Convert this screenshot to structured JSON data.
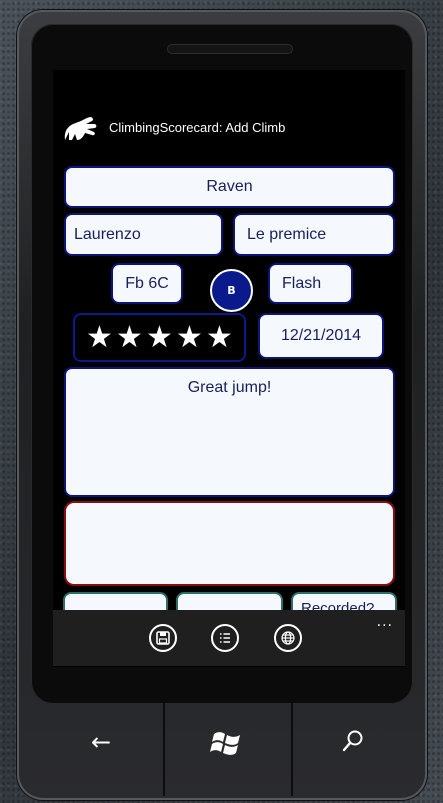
{
  "app": {
    "title": "ClimbingScorecard: Add Climb"
  },
  "form": {
    "route_name": "Raven",
    "climber": "Laurenzo",
    "problem": "Le premice",
    "grade": "Fb 6C",
    "badge": "B",
    "style": "Flash",
    "rating_stars": 5,
    "date": "12/21/2014",
    "comment": "Great jump!"
  },
  "bottom_tabs": [
    "",
    "",
    "Recorded?"
  ],
  "appbar": {
    "buttons": [
      "save-icon",
      "list-icon",
      "globe-icon"
    ],
    "more": "..."
  },
  "hardware": {
    "back": "←",
    "search": "⚲"
  },
  "colors": {
    "field_border": "#0d147a",
    "error_border": "#8a0c0c",
    "badge": "#0a1a8c"
  }
}
